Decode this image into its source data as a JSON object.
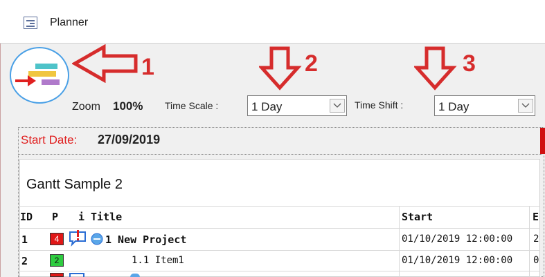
{
  "window": {
    "title": "Planner"
  },
  "annotations": [
    "1",
    "2",
    "3"
  ],
  "toolbar": {
    "zoom_label": "Zoom",
    "zoom_value": "100%",
    "time_scale_label": "Time Scale :",
    "time_scale_value": "1 Day",
    "time_shift_label": "Time Shift :",
    "time_shift_value": "1 Day"
  },
  "header": {
    "start_date_label": "Start Date:",
    "start_date_value": "27/09/2019"
  },
  "gantt": {
    "title": "Gantt Sample 2",
    "columns": {
      "id": "ID",
      "p": "P",
      "i": "i",
      "title": "Title",
      "start": "Start",
      "e": "E"
    },
    "rows": [
      {
        "id": "1",
        "p": "4",
        "title": "1 New Project",
        "start": "01/10/2019 12:00:00",
        "e": "2"
      },
      {
        "id": "2",
        "p": "2",
        "title": "1.1 Item1",
        "start": "01/10/2019 12:00:00",
        "e": "0"
      }
    ]
  },
  "colors": {
    "accent_red": "#d62c2c",
    "priority_red": "#e01818",
    "priority_green": "#2ecc40",
    "logo_ring": "#4aa0e6"
  }
}
